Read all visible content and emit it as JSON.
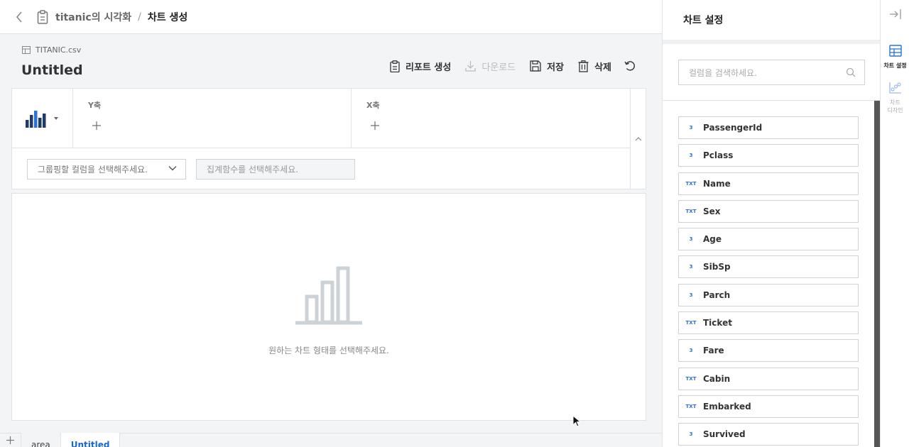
{
  "header": {
    "breadcrumb_parent": "titanic의 시각화",
    "breadcrumb_sep": "/",
    "breadcrumb_current": "차트 생성"
  },
  "main": {
    "file_name": "TITANIC.csv",
    "chart_title": "Untitled",
    "actions": {
      "report": "리포트 생성",
      "download": "다운로드",
      "save": "저장",
      "delete": "삭제"
    },
    "config": {
      "y_axis_label": "Y축",
      "x_axis_label": "X축",
      "group_placeholder": "그룹핑할 컬럼을 선택해주세요.",
      "agg_placeholder": "집계함수를 선택해주세요."
    },
    "empty_message": "원하는 차트 형태를 선택해주세요.",
    "tabs": [
      {
        "label": "area"
      },
      {
        "label": "Untitled"
      }
    ]
  },
  "panel": {
    "title": "차트 설정",
    "search_placeholder": "컬럼을 검색하세요.",
    "columns": [
      {
        "type": "3",
        "name": "PassengerId"
      },
      {
        "type": "3",
        "name": "Pclass"
      },
      {
        "type": "TXT",
        "name": "Name"
      },
      {
        "type": "TXT",
        "name": "Sex"
      },
      {
        "type": "3",
        "name": "Age"
      },
      {
        "type": "3",
        "name": "SibSp"
      },
      {
        "type": "3",
        "name": "Parch"
      },
      {
        "type": "TXT",
        "name": "Ticket"
      },
      {
        "type": "3",
        "name": "Fare"
      },
      {
        "type": "TXT",
        "name": "Cabin"
      },
      {
        "type": "TXT",
        "name": "Embarked"
      },
      {
        "type": "3",
        "name": "Survived"
      }
    ]
  },
  "rail": {
    "chart_settings": "차트 설정",
    "chart_design_1": "차트",
    "chart_design_2": "디자인"
  },
  "colors": {
    "accent": "#1a66d2",
    "type_badge": "#2b6fd6",
    "background": "#f2f4f6"
  }
}
